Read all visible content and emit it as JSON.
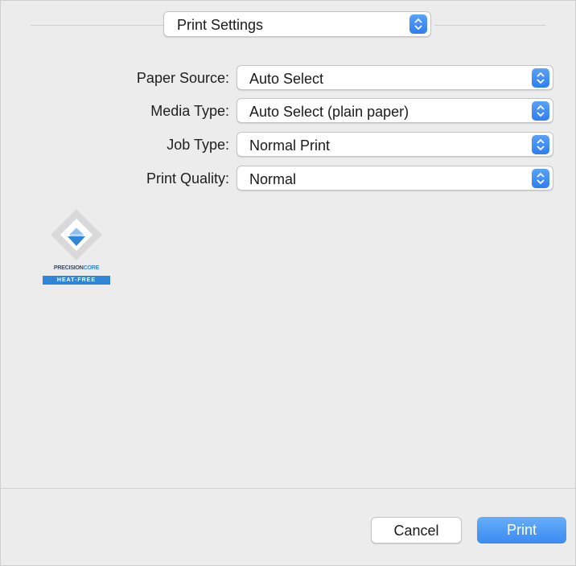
{
  "panel_selector": {
    "value": "Print Settings"
  },
  "settings": [
    {
      "label": "Paper Source:",
      "value": "Auto Select"
    },
    {
      "label": "Media Type:",
      "value": "Auto Select (plain paper)"
    },
    {
      "label": "Job Type:",
      "value": "Normal Print"
    },
    {
      "label": "Print Quality:",
      "value": "Normal"
    }
  ],
  "logo": {
    "brand_left": "PRECISION",
    "brand_right": "CORE",
    "tagline": "HEAT-FREE"
  },
  "buttons": {
    "cancel": "Cancel",
    "print": "Print"
  },
  "colors": {
    "accent": "#3a8af2",
    "background": "#ececec"
  }
}
